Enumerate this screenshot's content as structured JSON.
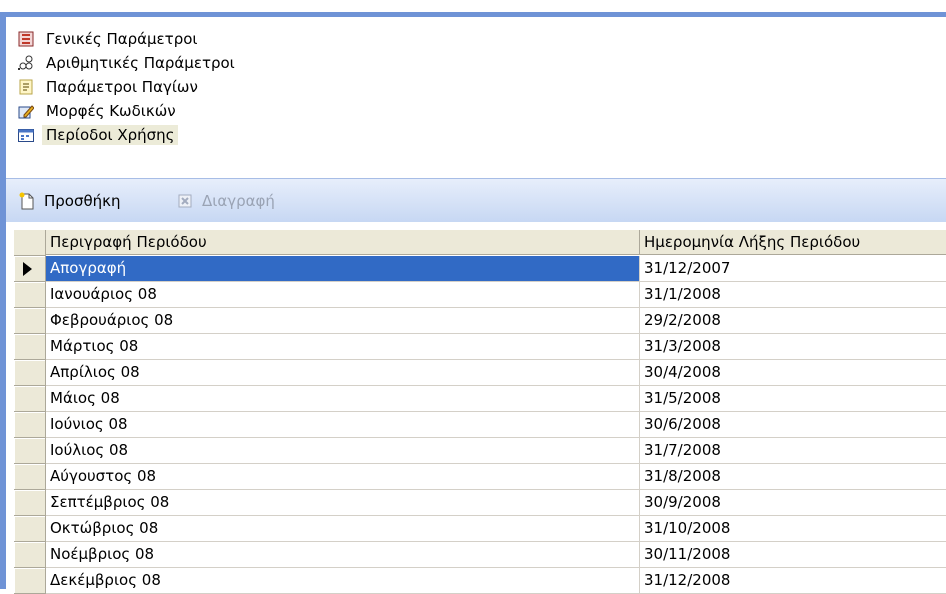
{
  "nav": {
    "items": [
      {
        "label": "Γενικές Παράμετροι",
        "icon": "general-settings-icon"
      },
      {
        "label": "Αριθμητικές Παράμετροι",
        "icon": "numeric-params-icon"
      },
      {
        "label": "Παράμετροι Παγίων",
        "icon": "fixed-assets-icon"
      },
      {
        "label": "Μορφές Κωδικών",
        "icon": "edit-codes-icon"
      },
      {
        "label": "Περίοδοι Χρήσης",
        "icon": "calendar-icon",
        "selected": true
      }
    ]
  },
  "toolbar": {
    "add_label": "Προσθήκη",
    "delete_label": "Διαγραφή"
  },
  "grid": {
    "columns": [
      "Περιγραφή Περιόδου",
      "Ημερομηνία Λήξης Περιόδου"
    ],
    "current_row": 0,
    "rows": [
      [
        "Απογραφή",
        "31/12/2007"
      ],
      [
        "Ιανουάριος 08",
        "31/1/2008"
      ],
      [
        "Φεβρουάριος 08",
        "29/2/2008"
      ],
      [
        "Μάρτιος 08",
        "31/3/2008"
      ],
      [
        "Απρίλιος 08",
        "30/4/2008"
      ],
      [
        "Μάιος 08",
        "31/5/2008"
      ],
      [
        "Ιούνιος 08",
        "30/6/2008"
      ],
      [
        "Ιούλιος 08",
        "31/7/2008"
      ],
      [
        "Αύγουστος 08",
        "31/8/2008"
      ],
      [
        "Σεπτέμβριος 08",
        "30/9/2008"
      ],
      [
        "Οκτώβριος 08",
        "31/10/2008"
      ],
      [
        "Νοέμβριος 08",
        "30/11/2008"
      ],
      [
        "Δεκέμβριος 08",
        "31/12/2008"
      ]
    ]
  },
  "colors": {
    "selection": "#316ac5",
    "frame": "#6f93d6",
    "header": "#ece9d8"
  }
}
